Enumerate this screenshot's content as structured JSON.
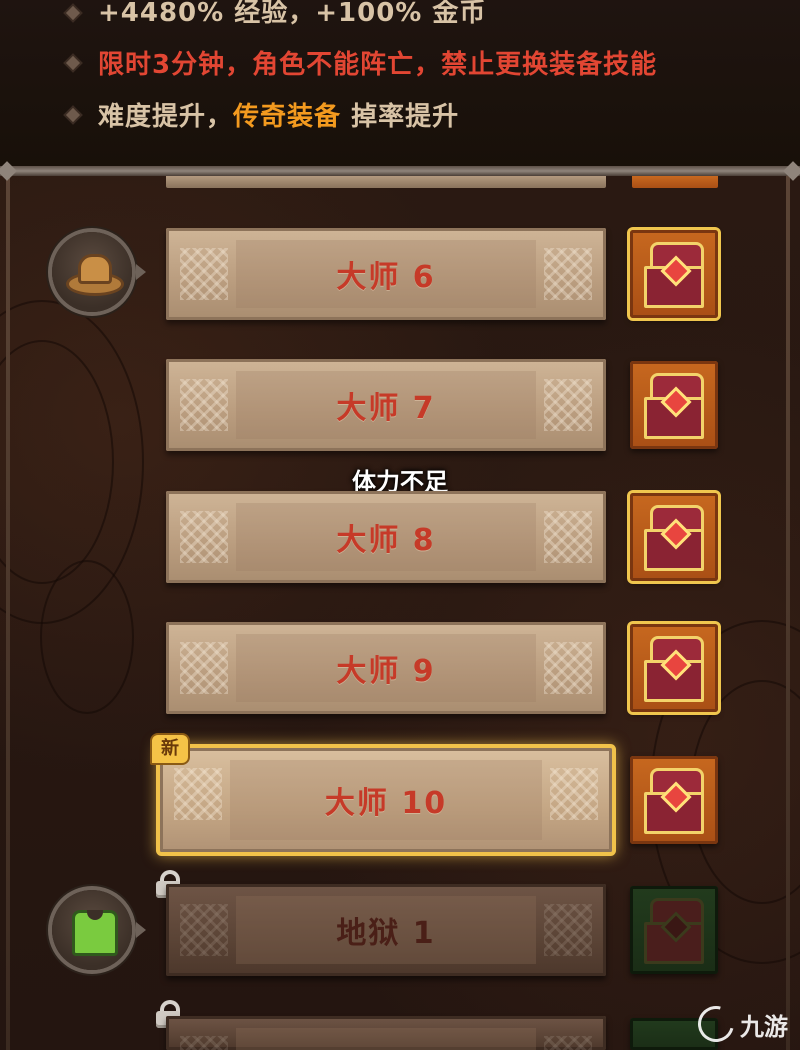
{
  "info": {
    "line1": "+4480% 经验，+100% 金币",
    "line2": "限时3分钟，角色不能阵亡，禁止更换装备技能",
    "line3_part1": "难度提升，",
    "line3_part2": "传奇装备",
    "line3_part3": " 掉率提升"
  },
  "stages": [
    {
      "label": "大师 6",
      "state": "normal"
    },
    {
      "label": "大师 7",
      "state": "normal"
    },
    {
      "label": "大师 8",
      "state": "normal"
    },
    {
      "label": "大师 9",
      "state": "normal"
    },
    {
      "label": "大师 10",
      "state": "selected"
    },
    {
      "label": "地狱 1",
      "state": "locked"
    }
  ],
  "new_badge": "新",
  "toast": "体力不足",
  "watermark": "九游",
  "colors": {
    "info_cream": "#d8c3a6",
    "info_red": "#e24633",
    "info_orange": "#f39a1f",
    "stage_label": "#c63a28",
    "selected_glow": "#f1c24a"
  },
  "icons": {
    "node_1": "straw-hat-icon",
    "node_2": "green-armor-icon",
    "lock": "padlock-icon",
    "reward": "treasure-chest-icon"
  }
}
